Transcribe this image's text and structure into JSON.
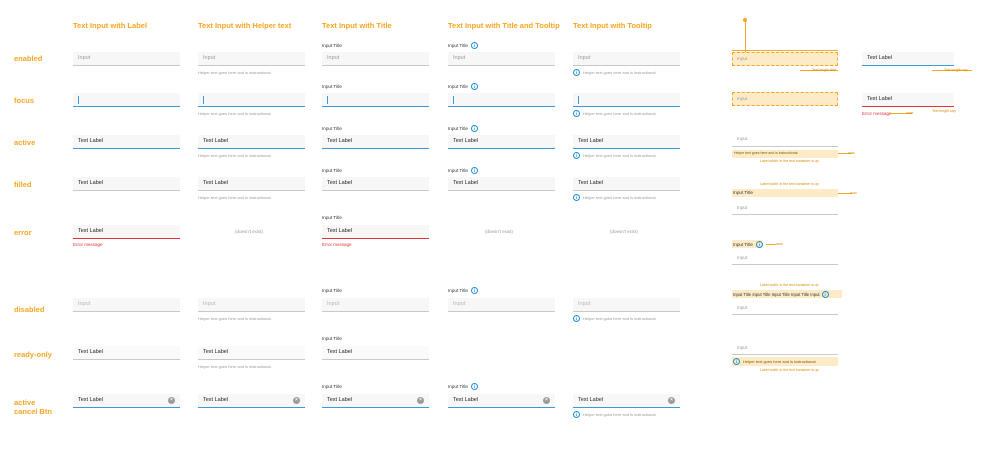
{
  "columns": [
    "Text Input with Label",
    "Text Input with Helper text",
    "Text Input with Title",
    "Text Input with Title and Tooltip",
    "Text Input with Tooltip"
  ],
  "rows": [
    "enabled",
    "focus",
    "active",
    "filled",
    "error",
    "disabled",
    "ready-only",
    "active",
    "cancel Btn"
  ],
  "common": {
    "placeholder": "Input",
    "text_label": "Text Label",
    "input_title": "Input Title",
    "helper": "Helper text goes here and is instructional.",
    "error_message": "Error message",
    "doesnt_exist": "(doesn't exist)",
    "tooltip_glyph": "i",
    "clear_glyph": "×",
    "icon_names": {
      "tooltip": "info-circle-icon",
      "clear": "clear-circle-icon"
    }
  },
  "spec": {
    "input": "Input",
    "text_label": "Text Label",
    "error_message": "Error message",
    "input_title": "Input Title",
    "long_title": "Input Title Input Title Input Title Input Title Input",
    "helper_line": "Helper text goes here and is instructional.",
    "helper_short": "Helper text goes here and is instructional.",
    "inset": "inset",
    "text_length_label": "Text length cap",
    "text_length_limit": "Text length limit",
    "limit_note": "Label width: in the text container is up",
    "auto_note": "auto",
    "icon_size": "Icon: Input title Input title left"
  },
  "colors": {
    "accent": "#f5a623",
    "focus_blue": "#3a9ad9",
    "error_red": "#e0333b",
    "field_bg": "#f7f7f7",
    "line_gray": "#c9c9c9"
  }
}
